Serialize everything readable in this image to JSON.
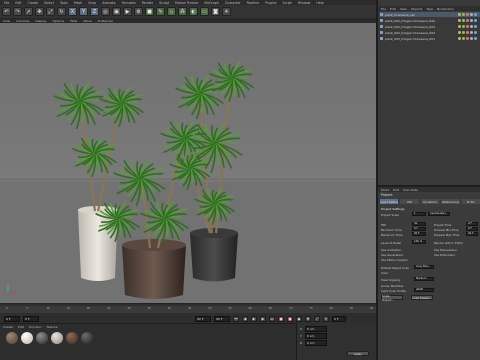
{
  "menubar": [
    "File",
    "Edit",
    "Create",
    "Select",
    "Tools",
    "Mesh",
    "Snap",
    "Animate",
    "Simulate",
    "Render",
    "Sculpt",
    "Motion Tracker",
    "MoGraph",
    "Character",
    "Pipeline",
    "Plugins",
    "Script",
    "Window",
    "Help"
  ],
  "viewport_menu": [
    "View",
    "Cameras",
    "Display",
    "Options",
    "Filter",
    "Panel",
    "ProRender"
  ],
  "toolbar_icons": [
    "undo-icon",
    "redo-icon",
    "select-icon",
    "move-icon",
    "scale-icon",
    "rotate-icon",
    "x-axis-icon",
    "y-axis-icon",
    "z-axis-icon",
    "world-icon",
    "render-region-icon",
    "render-view-icon",
    "render-settings-icon",
    "cube-icon",
    "pen-icon",
    "subdiv-icon",
    "array-icon",
    "deformer-icon",
    "floor-icon",
    "camera-icon",
    "light-icon"
  ],
  "objects": {
    "menu": [
      "File",
      "Edit",
      "View",
      "Objects",
      "Tags",
      "Bookmarks"
    ],
    "rows": [
      "plant_Dracaena_set",
      "plant_002_Dragon Dracaena_Kite",
      "plant_002_Dragon Dracaena_003",
      "plant_002_Dragon Dracaena_002",
      "plant_002_Dragon Dracaena_001"
    ]
  },
  "attributes": {
    "menu": [
      "Mode",
      "Edit",
      "User Data"
    ],
    "title": "Project",
    "tabs": [
      "Project Settings",
      "Info",
      "Dynamics",
      "Referencing",
      "To Do"
    ],
    "section": "Project Settings",
    "rows_left": [
      "Project Scale",
      "FPS",
      "Minimum Time",
      "Maximum Time",
      "Level of Detail",
      "Use Animation",
      "Use Generators",
      "Use Motion System",
      "Default Object Color",
      "Color",
      "View Clipping",
      "Linear Workflow",
      "Input Color Profile"
    ],
    "rows_right": [
      "Project Time",
      "Preview Min Time",
      "Preview Max Time",
      "Render LOD in Editor",
      "Use Expressions",
      "Use Deformers"
    ],
    "values": {
      "scale": "1",
      "scale_unit": "Centimeters",
      "fps": "30",
      "min_time": "0 F",
      "max_time": "90 F",
      "lod": "100 %",
      "proj_time": "0 F",
      "prev_min": "0 F",
      "prev_max": "90 F",
      "obj_color": "Gray Blue",
      "clip": "Medium",
      "color_profile": "sRGB"
    },
    "buttons": [
      "Scale Project...",
      "Load Preset..."
    ]
  },
  "timeline": {
    "frame_start": "0 F",
    "frame_current": "0 F",
    "frame_end": "90 F",
    "frame_end2": "90 F",
    "frame_counter": "0 F",
    "ticks": [
      "0",
      "5",
      "10",
      "15",
      "20",
      "25",
      "30",
      "35",
      "40",
      "45",
      "50",
      "55",
      "60",
      "65",
      "70",
      "75",
      "80",
      "85",
      "90"
    ]
  },
  "materials_menu": [
    "Create",
    "Edit",
    "Function",
    "Texture"
  ],
  "coords": {
    "labels": [
      "X",
      "Y",
      "Z"
    ],
    "values": [
      "0 cm",
      "0 cm",
      "0 cm"
    ],
    "apply": "Apply"
  },
  "colors": {
    "accent": "#5d7089",
    "record": "#9a3b33",
    "leaf": "#2f6e22",
    "leaf_light": "#5a9a3c"
  }
}
